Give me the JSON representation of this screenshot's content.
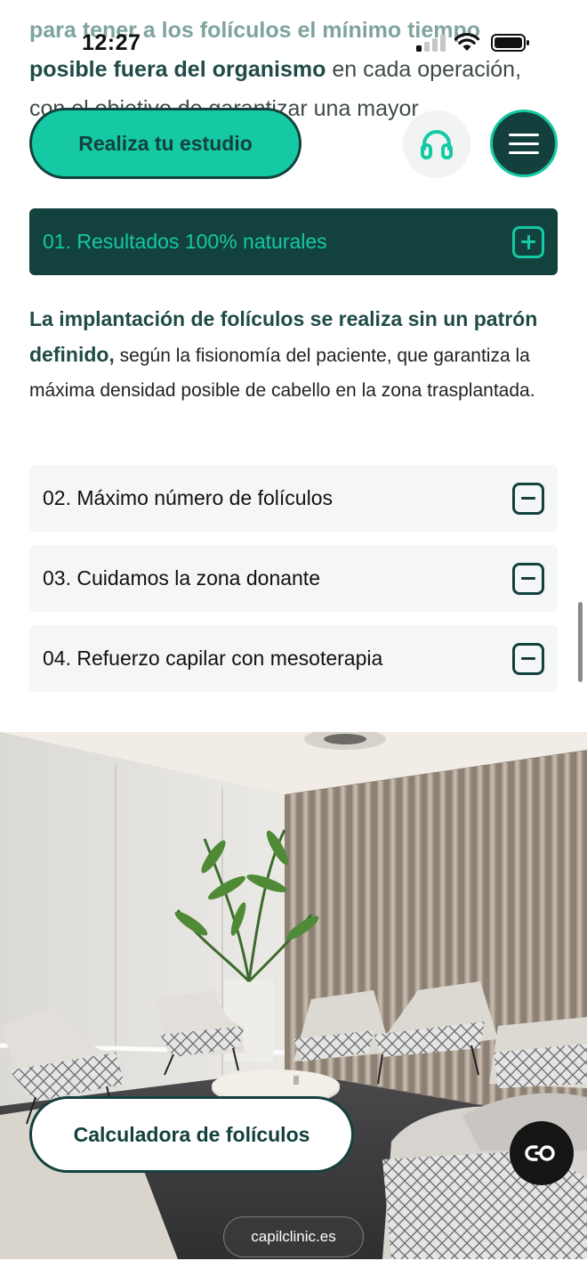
{
  "status_bar": {
    "time": "12:27"
  },
  "intro": {
    "line1": "para tener a los folículos el mínimo tiempo",
    "line2_bold": "posible fuera del organismo",
    "line2_rest": " en cada operación,",
    "line3": "con el objetivo de garantizar una mayor"
  },
  "header": {
    "cta_label": "Realiza tu estudio",
    "support_icon": "headset-icon",
    "menu_icon": "hamburger-menu-icon"
  },
  "accordion": {
    "items": [
      {
        "label": "01. Resultados 100% naturales",
        "state": "open"
      },
      {
        "label": "02. Máximo número de folículos",
        "state": "closed"
      },
      {
        "label": "03. Cuidamos la zona donante",
        "state": "closed"
      },
      {
        "label": "04. Refuerzo capilar con mesoterapia",
        "state": "closed"
      }
    ],
    "open_body": {
      "bold": "La implantación de folículos se realiza sin un patrón definido,",
      "rest": " según la fisionomía del paciente, que garantiza la máxima densidad posible de cabello en la zona trasplantada."
    }
  },
  "floating": {
    "calculator_label": "Calculadora de folículos",
    "chat_icon": "chat-link-icon"
  },
  "browser": {
    "url": "capilclinic.es"
  },
  "colors": {
    "brand_dark": "#13413d",
    "brand_accent": "#14c9a4"
  }
}
